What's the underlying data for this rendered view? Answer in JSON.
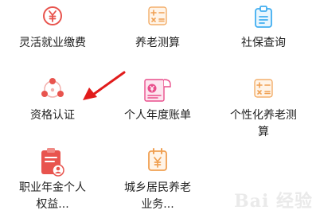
{
  "colors": {
    "red_icon": "#e8544e",
    "orange_icon": "#f0a052",
    "blue_icon": "#42aef0",
    "pink_icon": "#e94f8c",
    "arrow": "#e11b1b"
  },
  "items": [
    {
      "label": "灵活就业缴费",
      "icon": "yen-coin-icon"
    },
    {
      "label": "养老测算",
      "icon": "calculator-icon"
    },
    {
      "label": "社保查询",
      "icon": "clipboard-doc-icon"
    },
    {
      "label": "资格认证",
      "icon": "people-network-icon"
    },
    {
      "label": "个人年度账单",
      "icon": "scroll-bill-icon"
    },
    {
      "label": "个性化养老测\n算",
      "icon": "calculator-icon"
    },
    {
      "label": "职业年金个人\n权益...",
      "icon": "person-clipboard-icon"
    },
    {
      "label": "城乡居民养老\n业务...",
      "icon": "yen-calendar-icon"
    }
  ],
  "watermark": "Bai 经验"
}
